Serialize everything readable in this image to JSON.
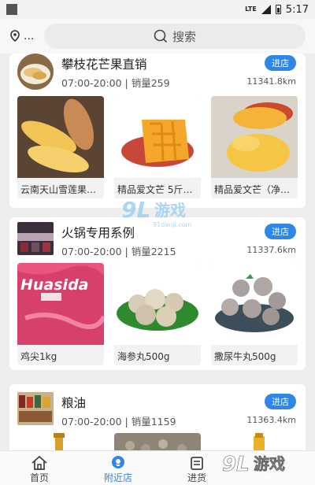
{
  "status_bar": {
    "network": "LTE",
    "time": "5:17"
  },
  "header": {
    "location_label": "...",
    "search_placeholder": "搜索"
  },
  "stores": [
    {
      "name": "攀枝花芒果直销",
      "hours_sales": "07:00-20:00 | 销量259",
      "distance": "11341.8km",
      "enter_label": "进店",
      "products": [
        "云南天山雪莲果…",
        "精品爱文芒 5斤…",
        "精品爱文芒（净…"
      ]
    },
    {
      "name": "火锅专用系例",
      "hours_sales": "07:00-20:00 | 销量2215",
      "distance": "11337.6km",
      "enter_label": "进店",
      "products": [
        "鸡尖1kg",
        "海参丸500g",
        "撒尿牛丸500g"
      ],
      "product_package_text": "Huasida"
    },
    {
      "name": "粮油",
      "hours_sales": "07:00-20:00 | 销量1159",
      "distance": "11363.4km",
      "enter_label": "进店",
      "products": []
    }
  ],
  "tabs": [
    {
      "label": "首页",
      "icon": "home-icon"
    },
    {
      "label": "附近店",
      "icon": "location-pin-icon",
      "active": true
    },
    {
      "label": "进货",
      "icon": "cart-icon"
    }
  ],
  "watermark": {
    "text": "游戏",
    "site": "91danji.com",
    "logo": "9L"
  },
  "colors": {
    "accent": "#2f86e9",
    "background": "#eeeeee",
    "card": "#ffffff"
  }
}
